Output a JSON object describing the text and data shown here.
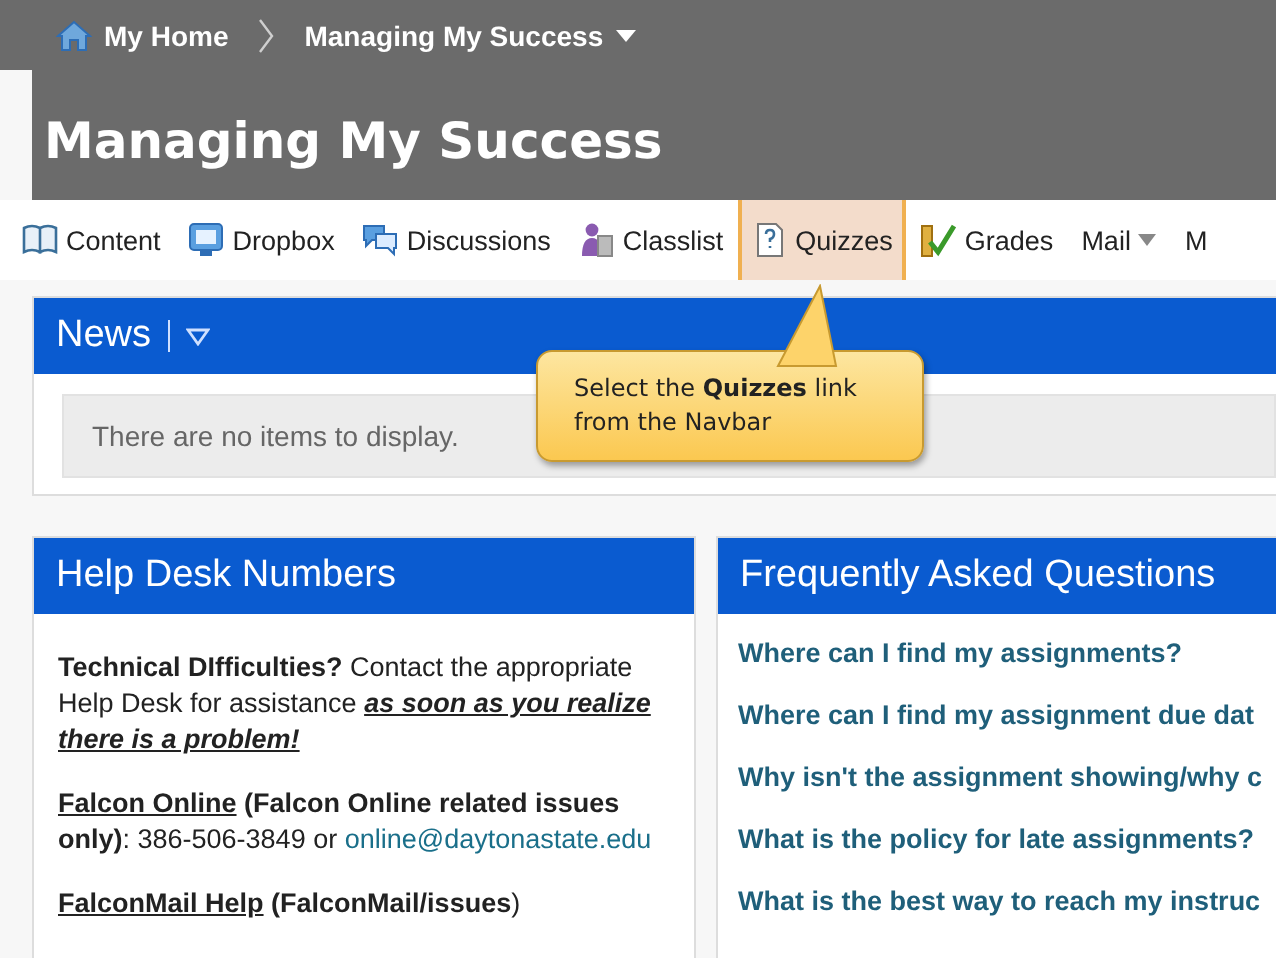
{
  "breadcrumb": {
    "home": "My Home",
    "course": "Managing My Success"
  },
  "course_title": "Managing My Success",
  "navbar": [
    {
      "label": "Content",
      "kind": "book",
      "selected": false,
      "menu": false
    },
    {
      "label": "Dropbox",
      "kind": "monitor",
      "selected": false,
      "menu": false
    },
    {
      "label": "Discussions",
      "kind": "bubbles",
      "selected": false,
      "menu": false
    },
    {
      "label": "Classlist",
      "kind": "person",
      "selected": false,
      "menu": false
    },
    {
      "label": "Quizzes",
      "kind": "quiz",
      "selected": true,
      "menu": false
    },
    {
      "label": "Grades",
      "kind": "grades",
      "selected": false,
      "menu": false
    },
    {
      "label": "Mail",
      "kind": "none",
      "selected": false,
      "menu": true
    },
    {
      "label": "M",
      "kind": "none",
      "selected": false,
      "menu": false
    }
  ],
  "news": {
    "title": "News",
    "empty_text": "There are no items to display."
  },
  "callout": "Select the **Quizzes** link from the Navbar",
  "help_desk": {
    "title": "Help Desk Numbers",
    "paragraphs": [
      {
        "parts": [
          {
            "kind": "text",
            "text": "**Technical DIfficulties?**  Contact the appropriate Help Desk for assistance "
          },
          {
            "kind": "emphasis",
            "text": "as soon as you realize there is a problem!"
          }
        ]
      },
      {
        "parts": [
          {
            "kind": "link",
            "text": "Falcon Online"
          },
          {
            "kind": "text",
            "text": " **(Falcon Online related issues only)**: 386-506-3849 or "
          },
          {
            "kind": "email",
            "text": "online@daytonastate.edu"
          }
        ]
      },
      {
        "parts": [
          {
            "kind": "link",
            "text": "FalconMail Help"
          },
          {
            "kind": "text",
            "text": " **(FalconMail/issues**)"
          }
        ]
      }
    ]
  },
  "faq": {
    "title": "Frequently Asked Questions",
    "items": [
      "Where can I find my assignments?",
      "Where can I find my assignment due dat",
      "Why isn't the assignment showing/why c",
      "What is the policy for late assignments?",
      "What is the best way to reach my instruc"
    ]
  }
}
